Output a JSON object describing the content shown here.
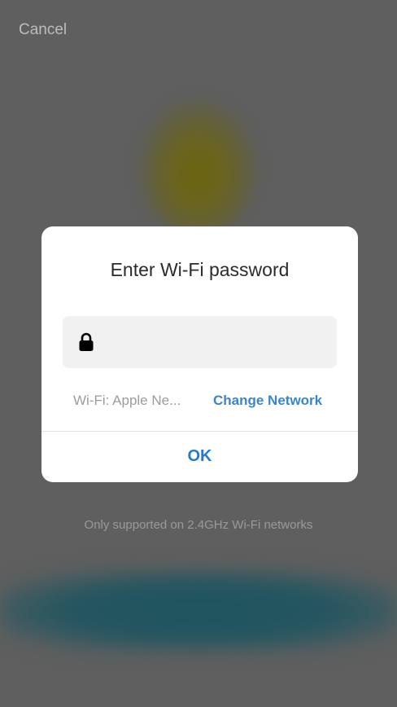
{
  "header": {
    "cancel_label": "Cancel"
  },
  "dialog": {
    "title": "Enter Wi-Fi password",
    "password_field": {
      "value": "",
      "placeholder": "",
      "icon": "lock-icon"
    },
    "network_label": "Wi-Fi: Apple Ne...",
    "change_network_label": "Change Network",
    "ok_label": "OK"
  },
  "footer": {
    "hint": "Only supported on 2.4GHz Wi-Fi networks"
  },
  "colors": {
    "accent": "#2a79c9",
    "link": "#3d86c6",
    "overlay": "#5f5f5f",
    "dialog_bg": "#ffffff"
  }
}
